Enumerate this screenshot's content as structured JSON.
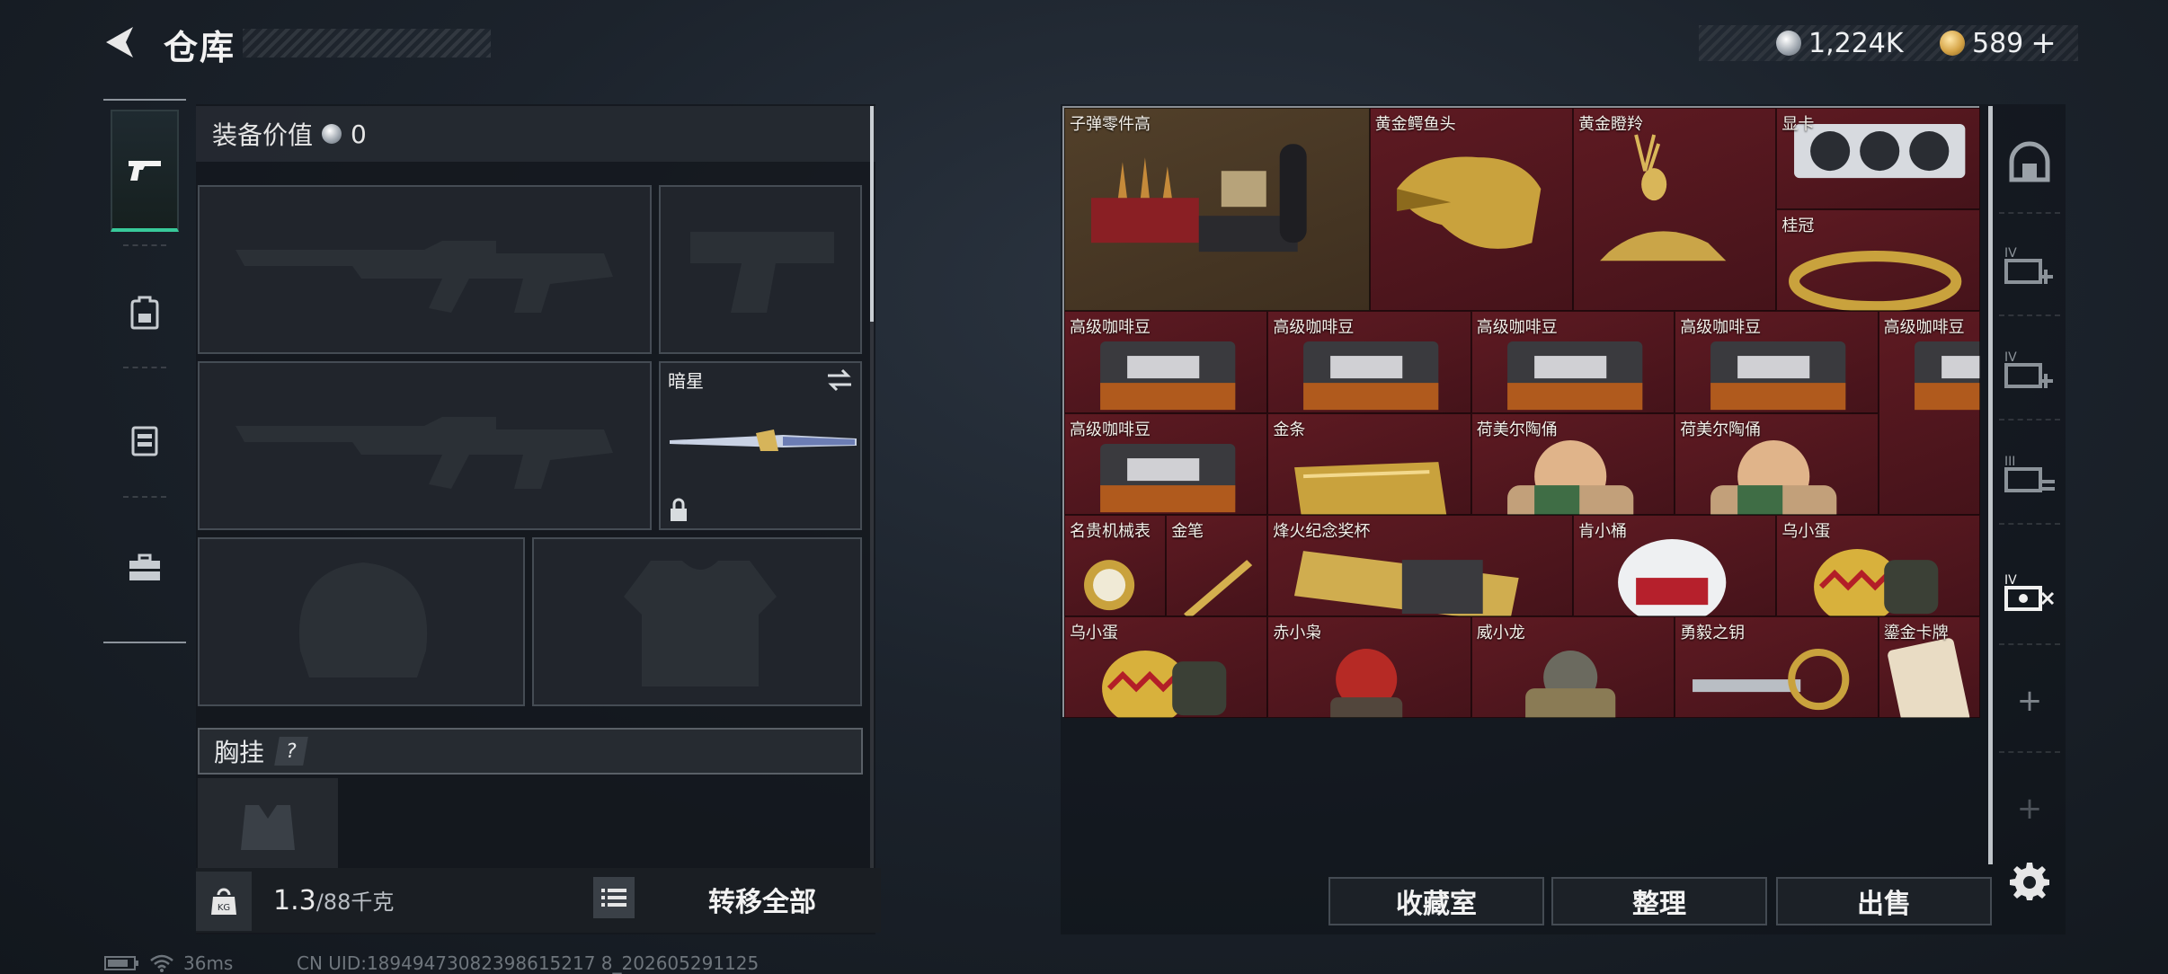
{
  "header": {
    "title": "仓库",
    "silver_amount": "1,224K",
    "gold_amount": "589",
    "gold_add": "+"
  },
  "left_tabs": [
    "pistol-icon",
    "backpack-icon",
    "vest-icon",
    "toolbox-icon"
  ],
  "loadout": {
    "equip_value_label": "装备价值",
    "equip_value": "0",
    "melee_label": "暗星",
    "chest_label": "胸挂",
    "chest_help": "?",
    "weight_value": "1.3",
    "weight_unit": "/88千克",
    "kg_badge": "KG",
    "transfer_all": "转移全部"
  },
  "stash": {
    "items": [
      {
        "label": "子弹零件高",
        "tint": "gold"
      },
      {
        "label": "黄金鳄鱼头",
        "tint": "red"
      },
      {
        "label": "黄金瞪羚",
        "tint": "red"
      },
      {
        "label": "显卡",
        "tint": "red"
      },
      {
        "label": "桂冠",
        "tint": "red"
      },
      {
        "label": "高级咖啡豆",
        "tint": "red"
      },
      {
        "label": "高级咖啡豆",
        "tint": "red"
      },
      {
        "label": "高级咖啡豆",
        "tint": "red"
      },
      {
        "label": "高级咖啡豆",
        "tint": "red"
      },
      {
        "label": "高级咖啡豆",
        "tint": "red"
      },
      {
        "label": "高级咖啡豆",
        "tint": "red"
      },
      {
        "label": "金条",
        "tint": "red"
      },
      {
        "label": "荷美尔陶俑",
        "tint": "red"
      },
      {
        "label": "荷美尔陶俑",
        "tint": "red"
      },
      {
        "label": "名贵机械表",
        "tint": "red"
      },
      {
        "label": "金笔",
        "tint": "red"
      },
      {
        "label": "烽火纪念奖杯",
        "tint": "red"
      },
      {
        "label": "肯小桶",
        "tint": "red"
      },
      {
        "label": "乌小蛋",
        "tint": "red"
      },
      {
        "label": "乌小蛋",
        "tint": "red"
      },
      {
        "label": "赤小枭",
        "tint": "red"
      },
      {
        "label": "威小龙",
        "tint": "red"
      },
      {
        "label": "勇毅之钥",
        "tint": "red"
      },
      {
        "label": "鎏金卡牌",
        "tint": "red"
      }
    ]
  },
  "right_tabs": {
    "tab_labels": [
      "IV",
      "IV",
      "III",
      "IV"
    ],
    "add_symbol": "+"
  },
  "actions": {
    "collection": "收藏室",
    "sort": "整理",
    "sell": "出售"
  },
  "status": {
    "ping": "36ms",
    "uid": "CN UID:18949473082398615217 8_202605291125"
  },
  "colors": {
    "accent_green": "#38c99a",
    "item_red": "#5e1a22",
    "item_gold": "#52402a"
  }
}
